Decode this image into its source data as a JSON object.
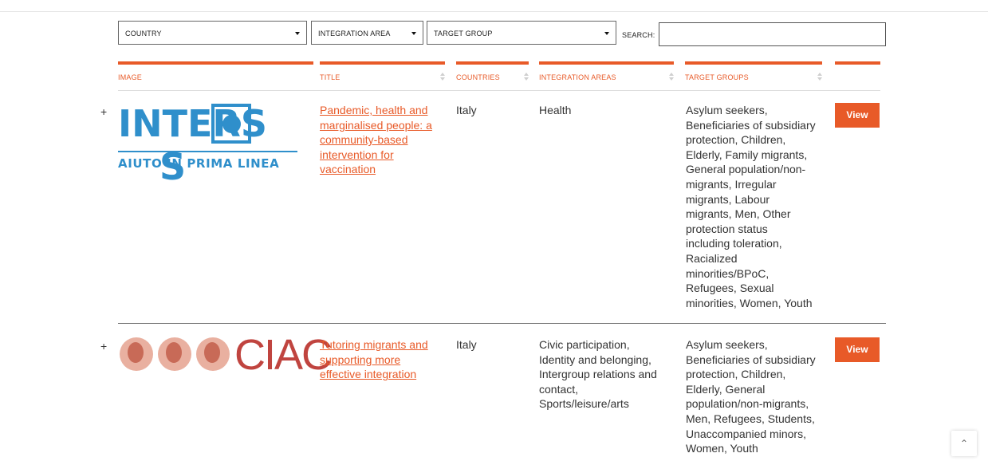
{
  "filters": {
    "country": "COUNTRY",
    "integration_area": "INTEGRATION AREA",
    "target_group": "TARGET GROUP",
    "search_label": "SEARCH:",
    "search_value": ""
  },
  "table": {
    "columns": [
      "IMAGE",
      "TITLE",
      "COUNTRIES",
      "INTEGRATION AREAS",
      "TARGET GROUPS"
    ],
    "rows": [
      {
        "expand": "+",
        "logo": {
          "word_prefix": "INTERS",
          "word_suffix": "S",
          "tagline": "AIUTO IN PRIMA LINEA"
        },
        "title_lines": [
          "Pandemic, health and",
          "marginalised people: a",
          "community-based",
          "intervention for",
          "vaccination"
        ],
        "country": "Italy",
        "areas_lines": [
          "Health"
        ],
        "groups_lines": [
          "Asylum seekers,",
          "Beneficiaries of subsidiary",
          "protection, Children,",
          "Elderly, Family migrants,",
          "General population/non-",
          "migrants, Irregular",
          "migrants, Labour",
          "migrants, Men, Other",
          "protection status",
          "including toleration,",
          "Racialized",
          "minorities/BPoC,",
          "Refugees, Sexual",
          "minorities, Women, Youth"
        ],
        "view_label": "View"
      },
      {
        "expand": "+",
        "logo": {
          "word": "CIAC"
        },
        "title_lines": [
          "Tutoring migrants and",
          "supporting more",
          "effective integration"
        ],
        "country": "Italy",
        "areas_lines": [
          "Civic participation,",
          "Identity and belonging,",
          "Intergroup relations and",
          "contact,",
          "Sports/leisure/arts"
        ],
        "groups_lines": [
          "Asylum seekers,",
          "Beneficiaries of subsidiary",
          "protection, Children,",
          "Elderly, General",
          "population/non-migrants,",
          "Men, Refugees, Students,",
          "Unaccompanied minors,",
          "Women, Youth"
        ],
        "view_label": "View"
      }
    ]
  },
  "scroll_top_icon": "chevron-up-icon",
  "colors": {
    "accent": "#e85a28",
    "logo_blue": "#2f8fcb",
    "logo_red": "#c0443f"
  }
}
